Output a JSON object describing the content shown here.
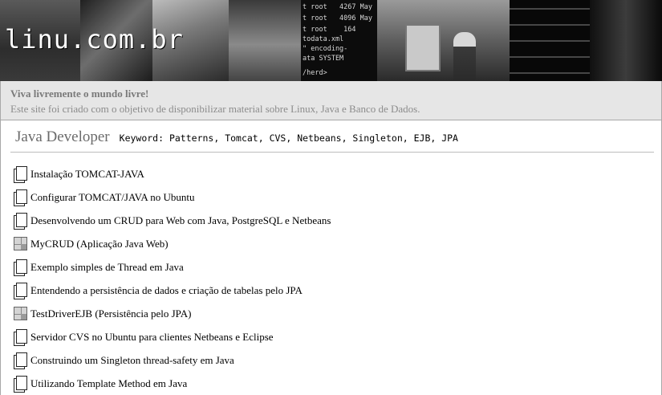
{
  "header": {
    "site_title": "linu.com.br",
    "terminal_lines": [
      "t root   4267 May",
      "t root   4096 May",
      "t root    164",
      "todata.xml",
      "\" encoding-",
      "ata SYSTEM",
      "/herd>"
    ]
  },
  "tagline": {
    "slogan": "Viva livremente o mundo livre!",
    "description": "Este site foi criado com o objetivo de disponibilizar material sobre Linux, Java e Banco de Dados."
  },
  "section": {
    "title": "Java Developer",
    "keyword": "Keyword: Patterns, Tomcat, CVS, Netbeans, Singleton, EJB, JPA"
  },
  "links": [
    {
      "label": "Instalação TOMCAT-JAVA",
      "icon": "document-icon"
    },
    {
      "label": "Configurar TOMCAT/JAVA no Ubuntu",
      "icon": "document-icon"
    },
    {
      "label": "Desenvolvendo um CRUD para Web com Java, PostgreSQL e Netbeans",
      "icon": "document-icon"
    },
    {
      "label": "MyCRUD (Aplicação Java Web)",
      "icon": "application-icon"
    },
    {
      "label": "Exemplo simples de Thread em Java",
      "icon": "document-icon"
    },
    {
      "label": "Entendendo a persistência de dados e criação de tabelas pelo JPA",
      "icon": "document-icon"
    },
    {
      "label": "TestDriverEJB (Persistência pelo JPA)",
      "icon": "application-icon"
    },
    {
      "label": "Servidor CVS no Ubuntu para clientes Netbeans e Eclipse",
      "icon": "document-icon"
    },
    {
      "label": "Construindo um Singleton thread-safety em Java",
      "icon": "document-icon"
    },
    {
      "label": "Utilizando Template Method em Java",
      "icon": "document-icon"
    }
  ],
  "colors": {
    "tagline_bg": "#e6e6e6",
    "section_title": "#6b6b6b",
    "slogan": "#7a7a7a"
  }
}
